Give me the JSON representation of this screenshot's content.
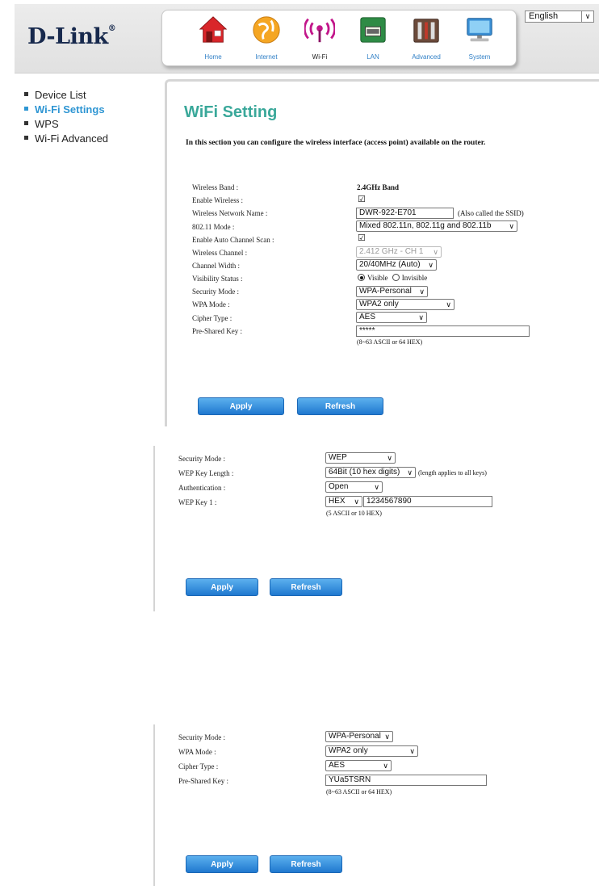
{
  "header": {
    "logo": "D-Link",
    "logo_mark": "®",
    "language": "English",
    "nav": [
      {
        "label": "Home",
        "icon": "home-icon"
      },
      {
        "label": "Internet",
        "icon": "globe-icon"
      },
      {
        "label": "Wi-Fi",
        "icon": "wifi-icon"
      },
      {
        "label": "LAN",
        "icon": "lan-icon"
      },
      {
        "label": "Advanced",
        "icon": "tools-icon"
      },
      {
        "label": "System",
        "icon": "monitor-icon"
      }
    ]
  },
  "sidebar": {
    "items": [
      {
        "label": "Device List"
      },
      {
        "label": "Wi-Fi Settings"
      },
      {
        "label": "WPS"
      },
      {
        "label": "Wi-Fi Advanced"
      }
    ]
  },
  "main": {
    "title": "WiFi Setting",
    "intro": "In this section you can configure the wireless interface (access point) available on the router.",
    "labels": {
      "band": "Wireless Band :",
      "enable": "Enable Wireless :",
      "ssid": "Wireless Network Name :",
      "mode": "802.11 Mode :",
      "auto_scan": "Enable Auto Channel Scan :",
      "channel": "Wireless Channel :",
      "width": "Channel Width :",
      "visibility": "Visibility Status :",
      "security": "Security Mode :",
      "wpa_mode": "WPA Mode :",
      "cipher": "Cipher Type :",
      "psk": "Pre-Shared Key :"
    },
    "values": {
      "band": "2.4GHz Band",
      "ssid": "DWR-922-E701",
      "ssid_note": "(Also called the SSID)",
      "mode": "Mixed 802.11n, 802.11g and 802.11b",
      "channel": "2.412 GHz - CH 1",
      "width": "20/40MHz (Auto)",
      "visible": "Visible",
      "invisible": "Invisible",
      "security": "WPA-Personal",
      "wpa_mode": "WPA2 only",
      "cipher": "AES",
      "psk": "*****",
      "psk_note": "(8~63 ASCII or 64 HEX)"
    },
    "apply": "Apply",
    "refresh": "Refresh"
  },
  "wep_panel": {
    "labels": {
      "security": "Security Mode :",
      "key_length": "WEP Key Length :",
      "auth": "Authentication :",
      "key1": "WEP Key 1 :"
    },
    "values": {
      "security": "WEP",
      "key_length": "64Bit (10 hex digits)",
      "key_length_note": "(length applies to all keys)",
      "auth": "Open",
      "key_format": "HEX",
      "key1": "1234567890",
      "key1_note": "(5 ASCII or 10 HEX)"
    },
    "apply": "Apply",
    "refresh": "Refresh"
  },
  "wpa_panel": {
    "labels": {
      "security": "Security Mode :",
      "wpa_mode": "WPA Mode :",
      "cipher": "Cipher Type :",
      "psk": "Pre-Shared Key :"
    },
    "values": {
      "security": "WPA-Personal",
      "wpa_mode": "WPA2 only",
      "cipher": "AES",
      "psk": "YUa5TSRN",
      "psk_note": "(8~63 ASCII or 64 HEX)"
    },
    "apply": "Apply",
    "refresh": "Refresh"
  }
}
